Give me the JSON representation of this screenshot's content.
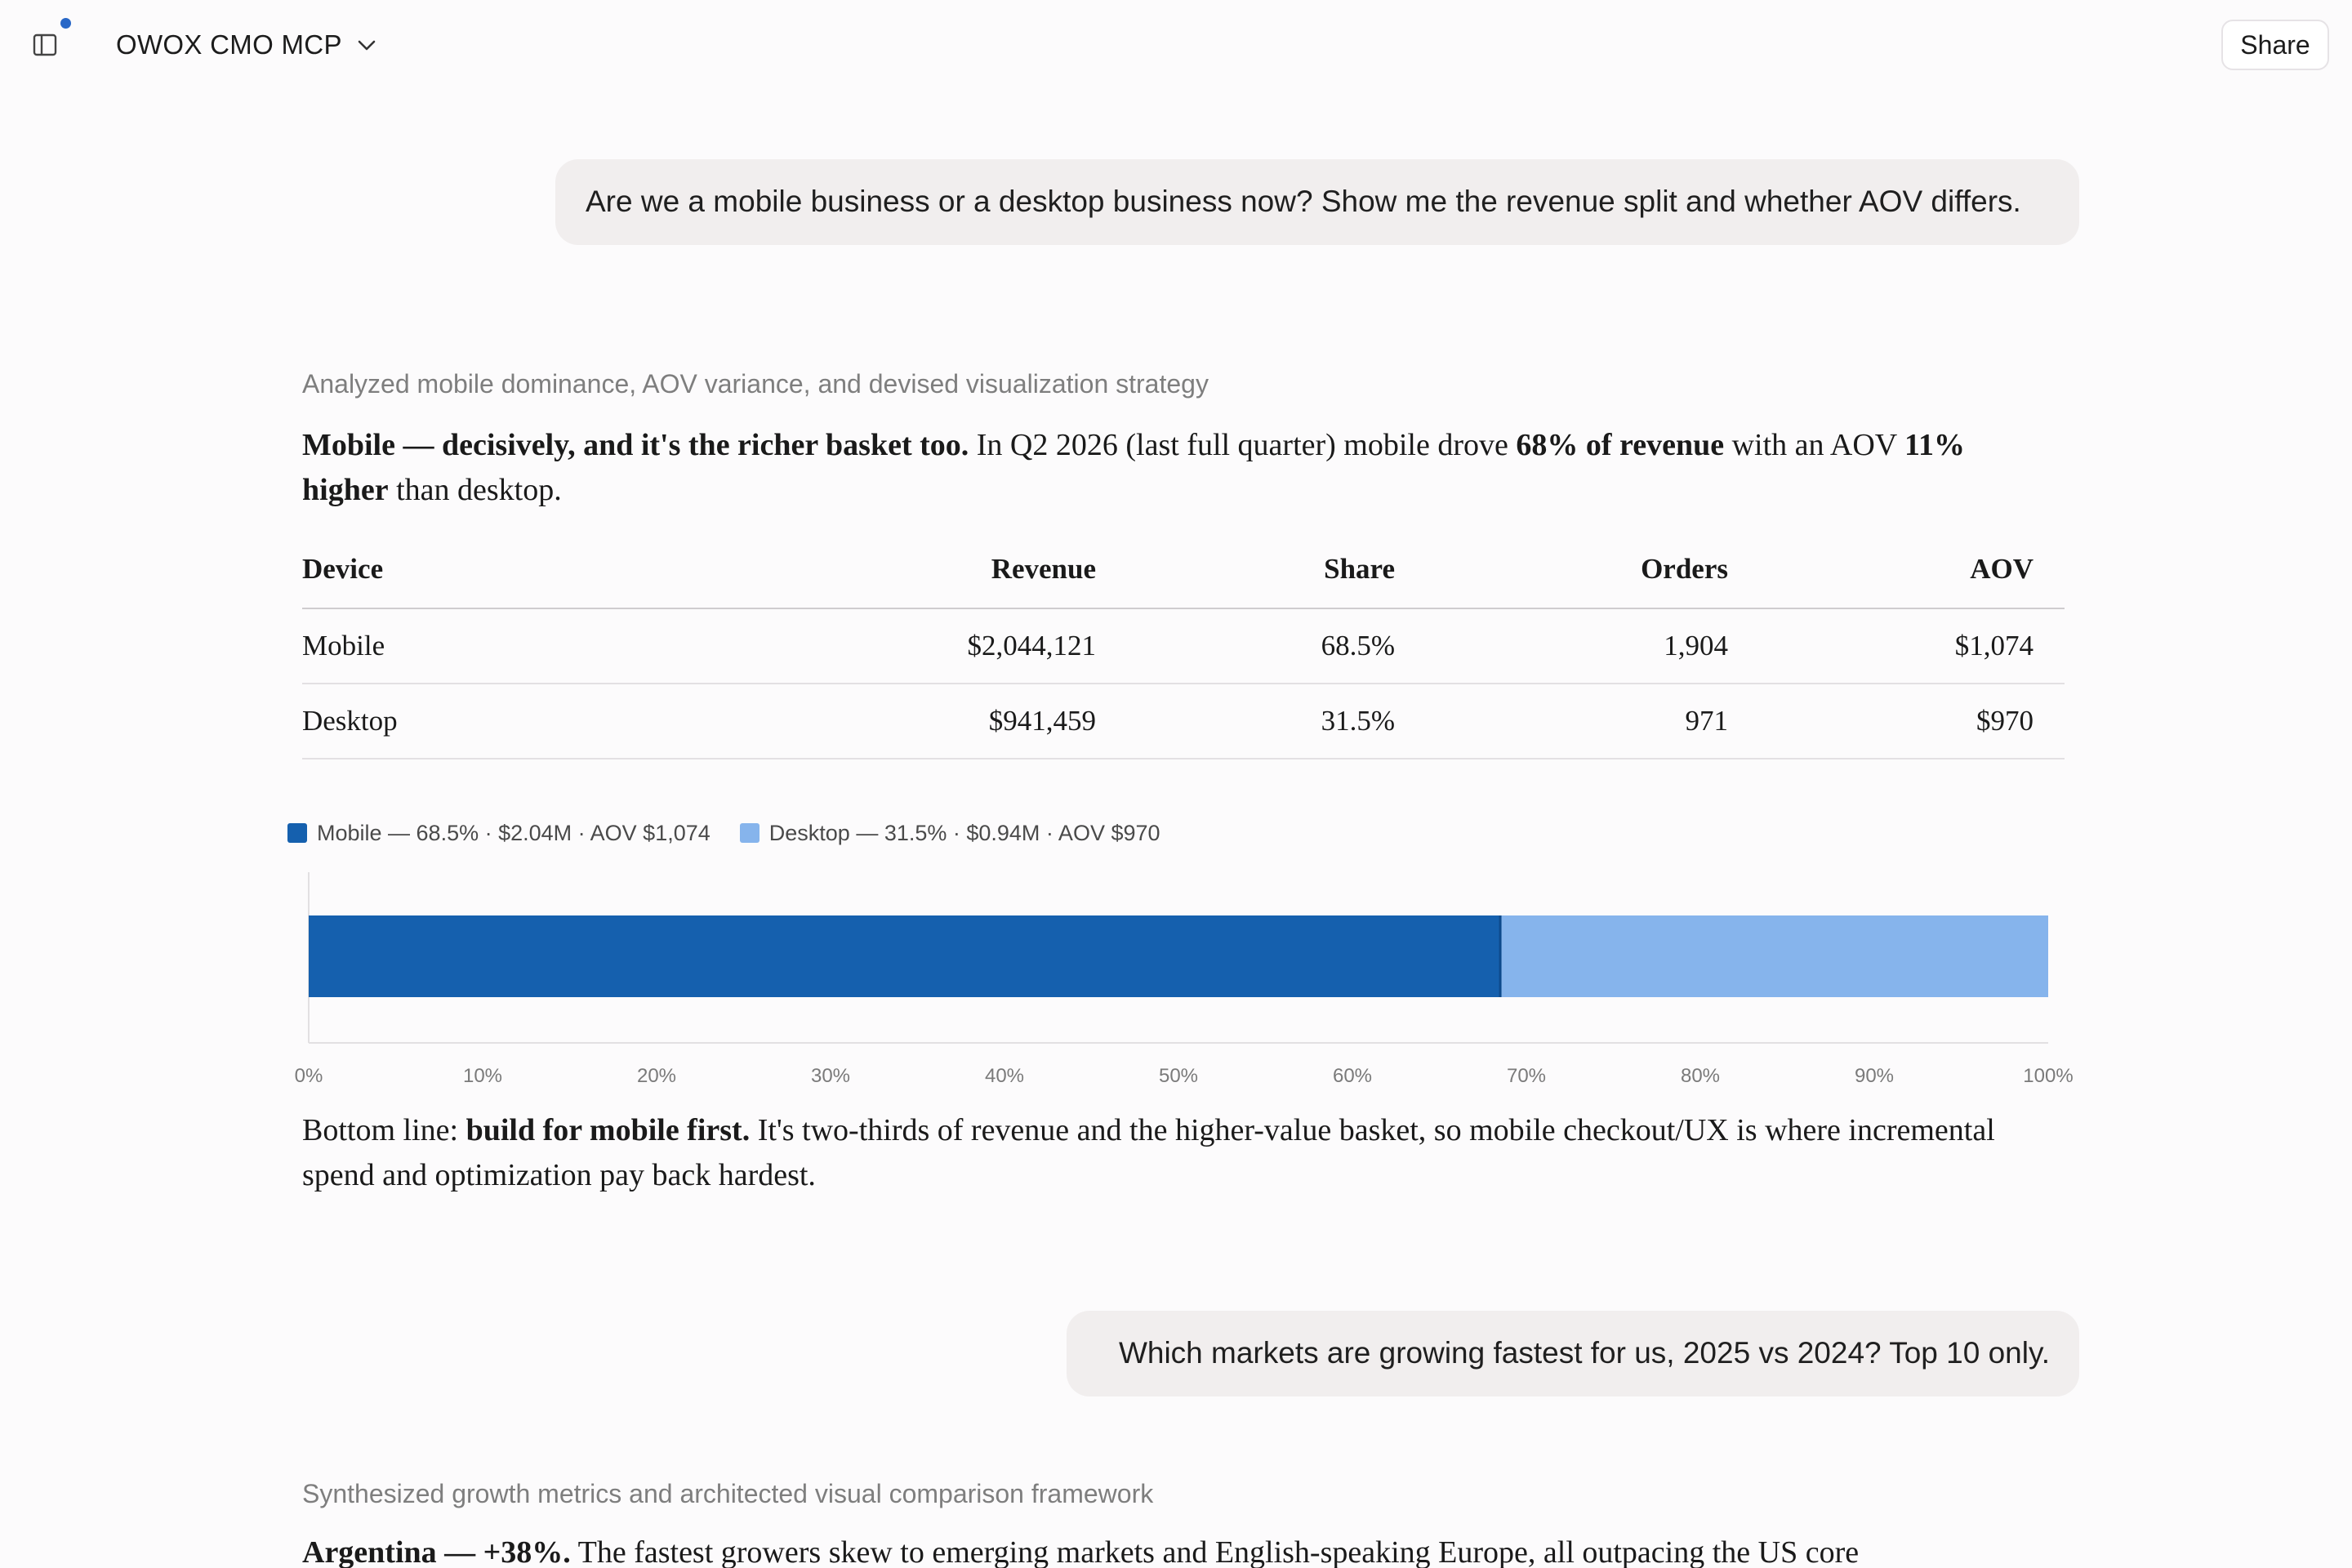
{
  "header": {
    "project_name": "OWOX CMO MCP",
    "share_label": "Share",
    "icons": [
      "sidebar-icon",
      "chevron-down-icon"
    ]
  },
  "conversation": {
    "message_1": {
      "user_text": "Are we a mobile business or a desktop business now? Show me the revenue split and whether AOV differs.",
      "thinking": "Analyzed mobile dominance, AOV variance, and devised visualization strategy",
      "answer_lead_bold": "Mobile — decisively, and it's the richer basket too.",
      "answer_text_1": " In Q2 2026 (last full quarter) mobile drove ",
      "answer_bold_2": "68% of revenue",
      "answer_text_2": " with an AOV ",
      "answer_bold_3": "11% higher",
      "answer_text_3": " than desktop.",
      "table": {
        "headers": {
          "device": "Device",
          "revenue": "Revenue",
          "share": "Share",
          "orders": "Orders",
          "aov": "AOV"
        },
        "rows": [
          {
            "device": "Mobile",
            "revenue": "$2,044,121",
            "share": "68.5%",
            "orders": "1,904",
            "aov": "$1,074"
          },
          {
            "device": "Desktop",
            "revenue": "$941,459",
            "share": "31.5%",
            "orders": "971",
            "aov": "$970"
          }
        ]
      },
      "bottom_line_prefix": "Bottom line: ",
      "bottom_line_bold": "build for mobile first.",
      "bottom_line_text": " It's two-thirds of revenue and the higher-value basket, so mobile checkout/UX is where incremental spend and optimization pay back hardest."
    },
    "message_2": {
      "user_text": "Which markets are growing fastest for us, 2025 vs 2024? Top 10 only.",
      "thinking": "Synthesized growth metrics and architected visual comparison framework",
      "answer_lead_bold": "Argentina — +38%.",
      "answer_text_1": " The fastest growers skew to emerging markets and English-speaking Europe, all outpacing the US core"
    }
  },
  "chart_data": {
    "type": "bar",
    "orientation": "horizontal-stacked",
    "categories": [
      ""
    ],
    "series": [
      {
        "name": "Mobile — 68.5% · $2.04M · AOV $1,074",
        "values": [
          68.5
        ],
        "color": "#1560ae"
      },
      {
        "name": "Desktop — 31.5% · $0.94M · AOV $970",
        "values": [
          31.5
        ],
        "color": "#86b4ec"
      }
    ],
    "xlim": [
      0,
      100
    ],
    "xticks": [
      "0%",
      "10%",
      "20%",
      "30%",
      "40%",
      "50%",
      "60%",
      "70%",
      "80%",
      "90%",
      "100%"
    ],
    "legend": "top-left",
    "grid": false
  },
  "colors": {
    "accent_dot": "#2867c7",
    "bubble_bg": "#f1eeee"
  }
}
